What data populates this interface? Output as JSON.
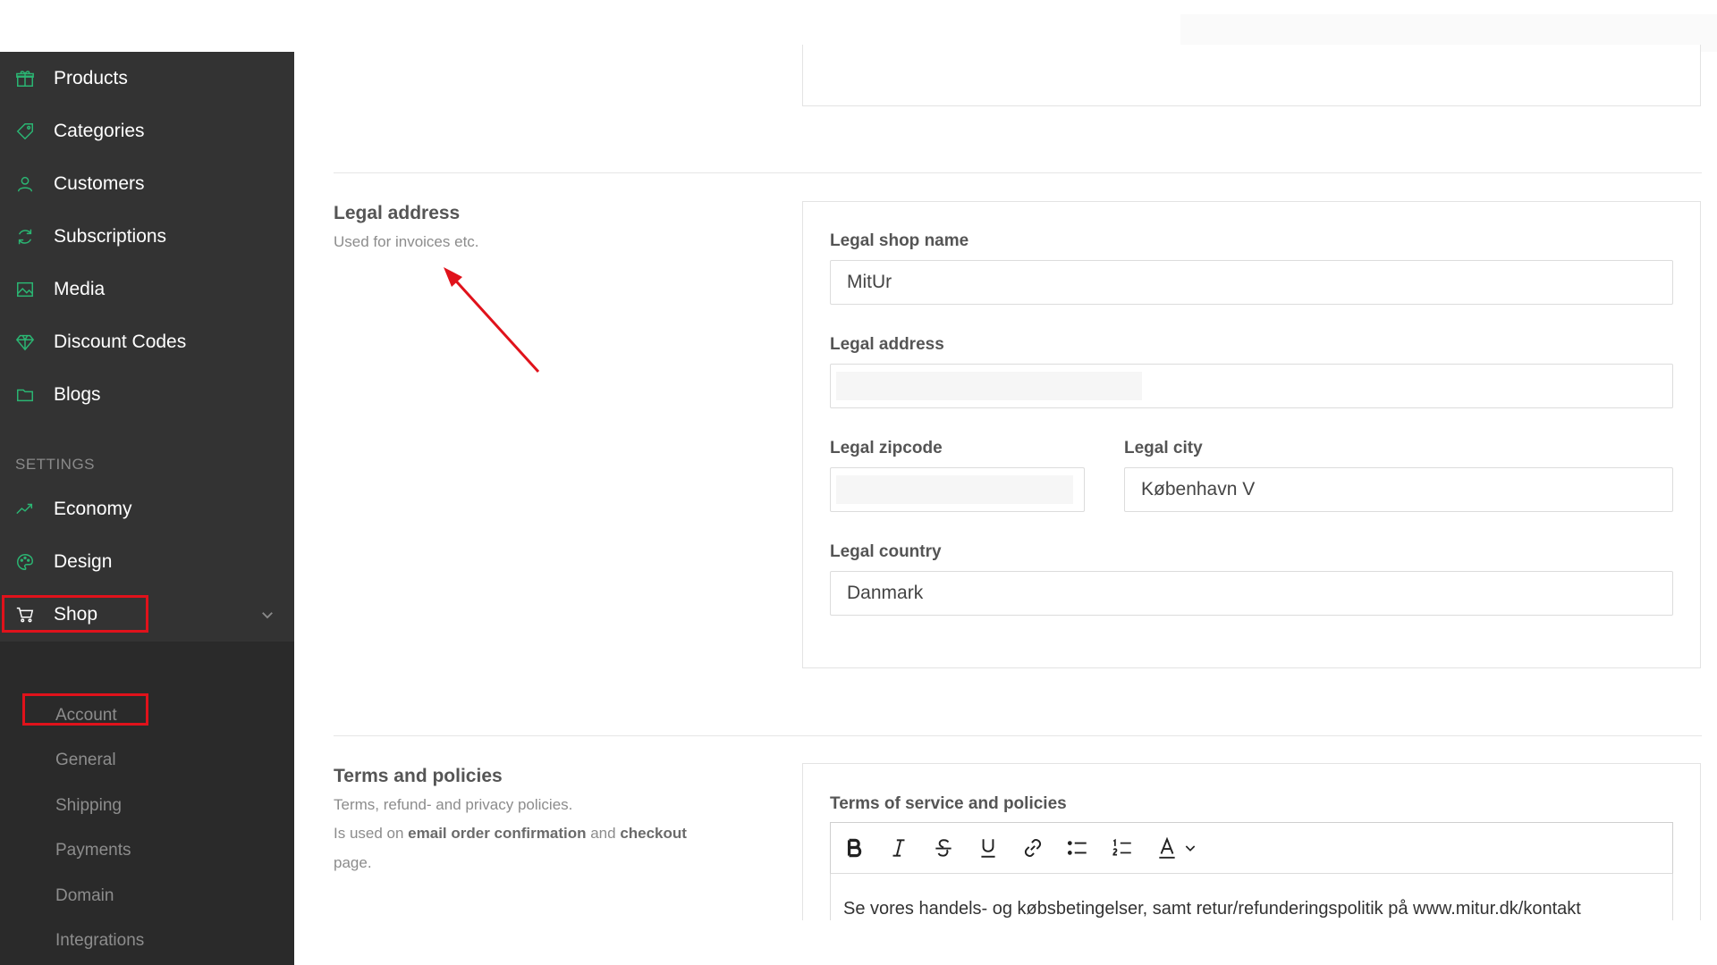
{
  "sidebar": {
    "items": [
      {
        "label": "Products",
        "icon": "gift-icon"
      },
      {
        "label": "Categories",
        "icon": "tag-icon"
      },
      {
        "label": "Customers",
        "icon": "user-icon"
      },
      {
        "label": "Subscriptions",
        "icon": "refresh-icon"
      },
      {
        "label": "Media",
        "icon": "image-icon"
      },
      {
        "label": "Discount Codes",
        "icon": "diamond-icon"
      },
      {
        "label": "Blogs",
        "icon": "folder-icon"
      }
    ],
    "settings_header": "SETTINGS",
    "settings_items": [
      {
        "label": "Economy",
        "icon": "trend-icon"
      },
      {
        "label": "Design",
        "icon": "palette-icon"
      },
      {
        "label": "Shop",
        "icon": "cart-icon"
      }
    ],
    "shop_submenu": [
      "Account",
      "General",
      "Shipping",
      "Payments",
      "Domain",
      "Integrations"
    ],
    "accent_color": "#2bb673"
  },
  "legal_section": {
    "title": "Legal address",
    "description": "Used for invoices etc.",
    "fields": {
      "shop_name": {
        "label": "Legal shop name",
        "value": "MitUr"
      },
      "address": {
        "label": "Legal address",
        "value": ""
      },
      "zipcode": {
        "label": "Legal zipcode",
        "value": ""
      },
      "city": {
        "label": "Legal city",
        "value": "København V"
      },
      "country": {
        "label": "Legal country",
        "value": "Danmark"
      }
    }
  },
  "terms_section": {
    "title": "Terms and policies",
    "description_line1": "Terms, refund- and privacy policies.",
    "description_line2_pre": "Is used on ",
    "description_line2_b1": "email order confirmation",
    "description_line2_mid": " and ",
    "description_line2_b2": "checkout",
    "description_line3": "page.",
    "editor_label": "Terms of service and policies",
    "editor_text": "Se vores handels- og købsbetingelser, samt retur/refunderingspolitik på www.mitur.dk/kontakt"
  },
  "annotation_color": "#e0121b"
}
